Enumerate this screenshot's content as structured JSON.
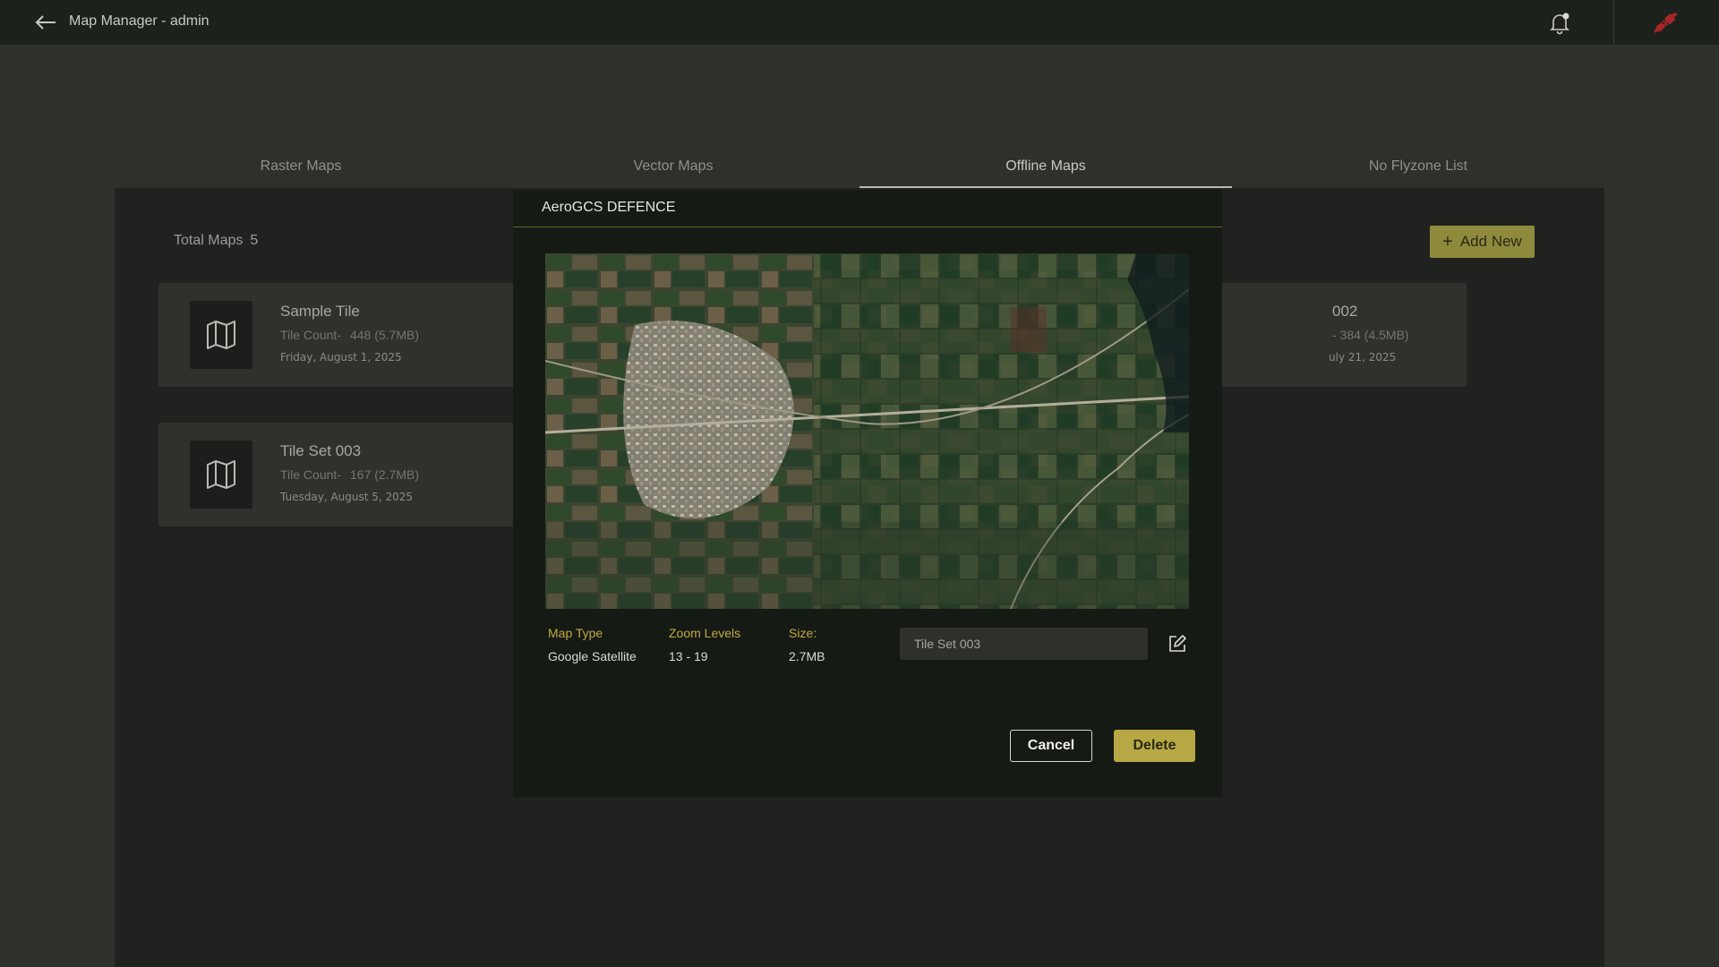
{
  "app": {
    "title": "Map Manager - admin"
  },
  "tabs": [
    {
      "label": "Raster Maps"
    },
    {
      "label": "Vector Maps"
    },
    {
      "label": "Offline Maps"
    },
    {
      "label": "No Flyzone List"
    }
  ],
  "active_tab": "Offline Maps",
  "summary": {
    "total_label": "Total Maps",
    "total_count": "5"
  },
  "add_new_label": "Add New",
  "cards": [
    {
      "name": "Sample Tile",
      "tile_label": "Tile Count-",
      "tile_value": "448 (5.7MB)",
      "date": "Friday, August 1, 2025"
    },
    {
      "name": "Tile Set 003",
      "tile_label": "Tile Count-",
      "tile_value": "167 (2.7MB)",
      "date": "Tuesday, August 5, 2025"
    }
  ],
  "card_right_partial": {
    "name": "002",
    "tiles": "-   384 (4.5MB)",
    "date": "uly 21, 2025"
  },
  "modal": {
    "title": "AeroGCS DEFENCE",
    "map_type_label": "Map Type",
    "map_type_value": "Google Satellite",
    "zoom_label": "Zoom Levels",
    "zoom_value": "13 - 19",
    "size_label": "Size:",
    "size_value": "2.7MB",
    "name_value": "Tile Set 003",
    "cancel_label": "Cancel",
    "delete_label": "Delete"
  },
  "icons": {
    "back": "arrow-left-icon",
    "notifications": "bell-icon",
    "connection": "plug-disconnected-icon",
    "map": "map-icon",
    "edit": "edit-icon",
    "add": "plus-icon"
  },
  "colors": {
    "accent": "#b8a845",
    "label_gold": "#bfa945",
    "disconnected": "#a8262a"
  }
}
